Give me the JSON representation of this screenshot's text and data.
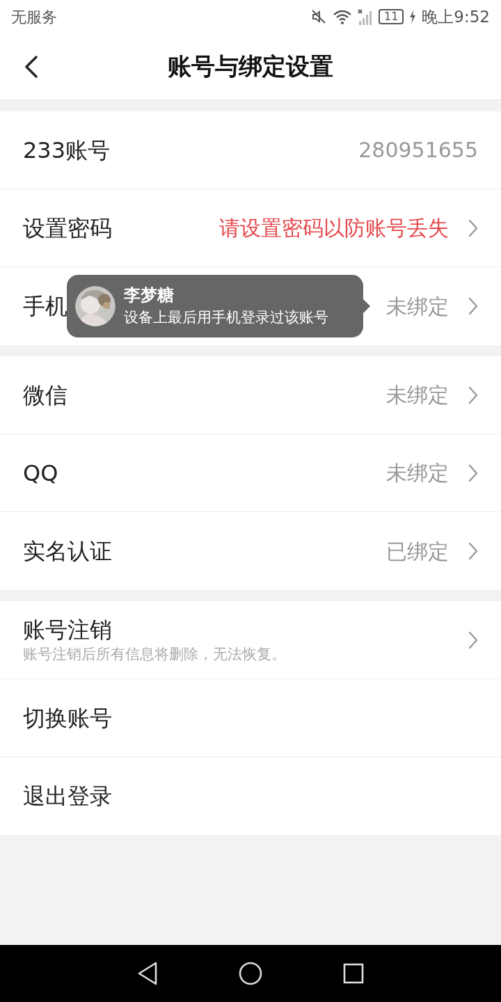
{
  "status_bar": {
    "carrier": "无服务",
    "battery": "11",
    "time": "晚上9:52"
  },
  "header": {
    "title": "账号与绑定设置"
  },
  "groups": [
    {
      "rows": [
        {
          "label": "233账号",
          "value": "280951655",
          "kind": "plain",
          "chevron": false
        },
        {
          "label": "设置密码",
          "value": "请设置密码以防账号丢失",
          "kind": "warning",
          "chevron": true
        },
        {
          "label": "手机",
          "value": "未绑定",
          "kind": "plain",
          "chevron": true,
          "tooltip": {
            "name": "李梦糖",
            "message": "设备上最后用手机登录过该账号"
          }
        }
      ]
    },
    {
      "rows": [
        {
          "label": "微信",
          "value": "未绑定",
          "kind": "plain",
          "chevron": true
        },
        {
          "label": "QQ",
          "value": "未绑定",
          "kind": "plain",
          "chevron": true
        },
        {
          "label": "实名认证",
          "value": "已绑定",
          "kind": "plain",
          "chevron": true
        }
      ]
    },
    {
      "rows": [
        {
          "label": "账号注销",
          "subtitle": "账号注销后所有信息将删除，无法恢复。",
          "chevron": true
        },
        {
          "label": "切换账号",
          "chevron": false
        },
        {
          "label": "退出登录",
          "chevron": false
        }
      ]
    }
  ]
}
